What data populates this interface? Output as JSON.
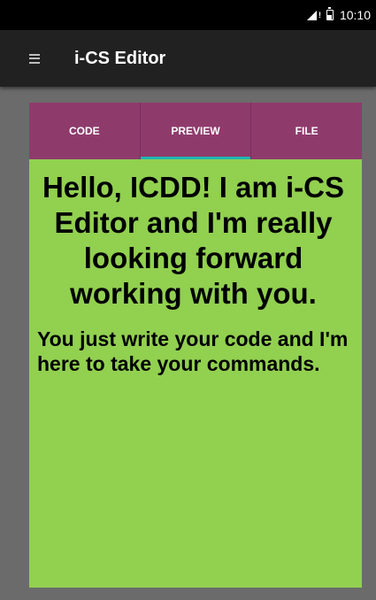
{
  "status_bar": {
    "time": "10:10",
    "icons": [
      "signal-icon",
      "battery-icon"
    ]
  },
  "app_bar": {
    "title": "i-CS Editor",
    "menu_icon": "hamburger-menu-icon"
  },
  "tabs": [
    {
      "label": "CODE",
      "active": false
    },
    {
      "label": "PREVIEW",
      "active": true
    },
    {
      "label": "FILE",
      "active": false
    }
  ],
  "preview": {
    "heading": "Hello, ICDD! I am i-CS Editor and I'm really looking forward working with you.",
    "paragraph": "You just write your code and I'm here to take your commands."
  },
  "colors": {
    "tab_bar": "#8e3b6c",
    "tab_indicator": "#1fb5b2",
    "preview_background": "#92d050",
    "app_bar": "#212121",
    "status_bar": "#000000",
    "page_background": "#6b6b6b"
  }
}
